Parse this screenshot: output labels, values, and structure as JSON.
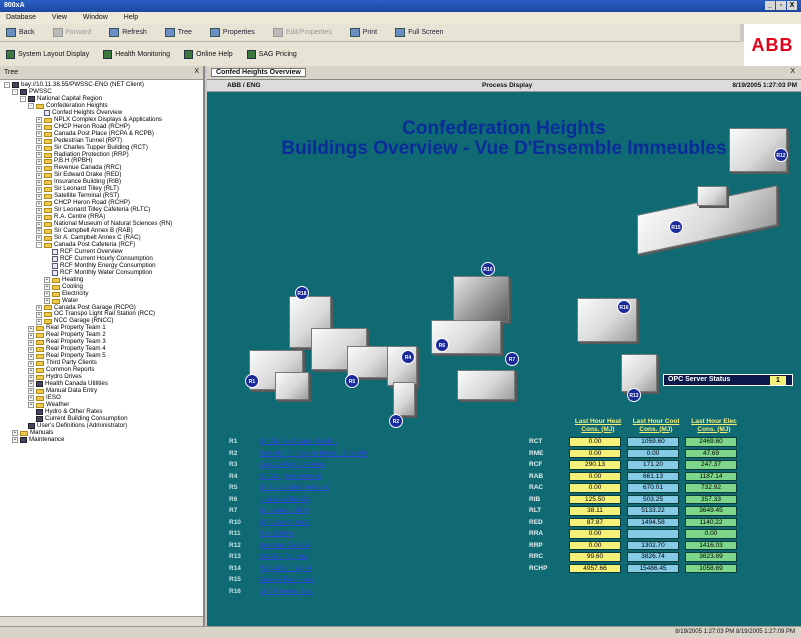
{
  "window": {
    "title": "800xA",
    "controls": [
      "_",
      "▫",
      "X"
    ]
  },
  "menu": [
    "Database",
    "View",
    "Window",
    "Help"
  ],
  "toolbar": [
    {
      "label": "Back",
      "icon": "back-arrow-icon",
      "enabled": true
    },
    {
      "label": "Forward",
      "icon": "forward-arrow-icon",
      "enabled": false
    },
    {
      "label": "Refresh",
      "icon": "refresh-icon",
      "enabled": true
    },
    {
      "label": "Tree",
      "icon": "tree-icon",
      "enabled": true
    },
    {
      "label": "Properties",
      "icon": "properties-icon",
      "enabled": true
    },
    {
      "label": "Edit/Properties",
      "icon": "edit-icon",
      "enabled": false
    },
    {
      "label": "Print",
      "icon": "print-icon",
      "enabled": true
    },
    {
      "label": "Full Screen",
      "icon": "fullscreen-icon",
      "enabled": true
    }
  ],
  "toolbar2": [
    {
      "label": "System Layout Display",
      "icon": "layout-icon"
    },
    {
      "label": "Health Monitoring",
      "icon": "health-icon"
    },
    {
      "label": "Online Help",
      "icon": "help-icon"
    },
    {
      "label": "SAG Pricing",
      "icon": "pricing-icon"
    }
  ],
  "brand": {
    "logo_text": "ABB",
    "color": "#e3001b"
  },
  "tree_panel": {
    "header": "Tree",
    "close": "X",
    "nodes": [
      {
        "label": "bay://10.11.38.55/PWSSC-ENG (NET Client)",
        "depth": 0,
        "icon": "srv",
        "exp": "-"
      },
      {
        "label": "PWSSC",
        "depth": 1,
        "icon": "srv",
        "exp": "-"
      },
      {
        "label": "National Capital Region",
        "depth": 2,
        "icon": "srv",
        "exp": "-"
      },
      {
        "label": "Confederation Heights",
        "depth": 3,
        "icon": "fld",
        "exp": "-"
      },
      {
        "label": "Confed Heights Overview",
        "depth": 4,
        "icon": "doc",
        "exp": ""
      },
      {
        "label": "NPLX Complex Displays & Applications",
        "depth": 4,
        "icon": "fld",
        "exp": "+"
      },
      {
        "label": "CHCP Heron Road (RCHP)",
        "depth": 4,
        "icon": "fld",
        "exp": "+"
      },
      {
        "label": "Canada Post Place (RCPA & RCPB)",
        "depth": 4,
        "icon": "fld",
        "exp": "+"
      },
      {
        "label": "Pedestrian Tunnel (RPT)",
        "depth": 4,
        "icon": "fld",
        "exp": "+"
      },
      {
        "label": "Sir Charles Tupper Building (RCT)",
        "depth": 4,
        "icon": "fld",
        "exp": "+"
      },
      {
        "label": "Radiation Protection (RRP)",
        "depth": 4,
        "icon": "fld",
        "exp": "+"
      },
      {
        "label": "P.B.H (RPBH)",
        "depth": 4,
        "icon": "fld",
        "exp": "+"
      },
      {
        "label": "Revenue Canada (RRC)",
        "depth": 4,
        "icon": "fld",
        "exp": "+"
      },
      {
        "label": "Sir Edward Drake (RED)",
        "depth": 4,
        "icon": "fld",
        "exp": "+"
      },
      {
        "label": "Insurance Building (RIB)",
        "depth": 4,
        "icon": "fld",
        "exp": "+"
      },
      {
        "label": "Sir Leonard Tilley (RLT)",
        "depth": 4,
        "icon": "fld",
        "exp": "+"
      },
      {
        "label": "Satellite Terminal (RST)",
        "depth": 4,
        "icon": "fld",
        "exp": "+"
      },
      {
        "label": "CHCP Heron Road (RCHP)",
        "depth": 4,
        "icon": "fld",
        "exp": "+"
      },
      {
        "label": "Sir Leonard Tilley Cafeteria (RLTC)",
        "depth": 4,
        "icon": "fld",
        "exp": "+"
      },
      {
        "label": "R.A. Centre (RRA)",
        "depth": 4,
        "icon": "fld",
        "exp": "+"
      },
      {
        "label": "National Museum of Natural Sciences (RN)",
        "depth": 4,
        "icon": "fld",
        "exp": "+"
      },
      {
        "label": "Sir Campbell Annex B (RAB)",
        "depth": 4,
        "icon": "fld",
        "exp": "+"
      },
      {
        "label": "Sir A. Campbell Annex C (RAC)",
        "depth": 4,
        "icon": "fld",
        "exp": "+"
      },
      {
        "label": "Canada Post Cafeteria (RCF)",
        "depth": 4,
        "icon": "fld",
        "exp": "-"
      },
      {
        "label": "RCF Current Overview",
        "depth": 5,
        "icon": "doc",
        "exp": ""
      },
      {
        "label": "RCF Current Hourly Consumption",
        "depth": 5,
        "icon": "doc",
        "exp": ""
      },
      {
        "label": "RCF Monthly Energy Consumption",
        "depth": 5,
        "icon": "doc",
        "exp": ""
      },
      {
        "label": "RCF Monthly Water Consumption",
        "depth": 5,
        "icon": "doc",
        "exp": ""
      },
      {
        "label": "Heating",
        "depth": 5,
        "icon": "fld",
        "exp": "+"
      },
      {
        "label": "Cooling",
        "depth": 5,
        "icon": "fld",
        "exp": "+"
      },
      {
        "label": "Electricity",
        "depth": 5,
        "icon": "fld",
        "exp": "+"
      },
      {
        "label": "Water",
        "depth": 5,
        "icon": "fld",
        "exp": "+"
      },
      {
        "label": "Canada Post Garage (RCPG)",
        "depth": 4,
        "icon": "fld",
        "exp": "+"
      },
      {
        "label": "OC Transpo Light Rail Station (RCC)",
        "depth": 4,
        "icon": "fld",
        "exp": "+"
      },
      {
        "label": "NCC Garage (RNCC)",
        "depth": 4,
        "icon": "fld",
        "exp": "+"
      },
      {
        "label": "Real Property Team 1",
        "depth": 3,
        "icon": "fld",
        "exp": "+"
      },
      {
        "label": "Real Property Team 2",
        "depth": 3,
        "icon": "fld",
        "exp": "+"
      },
      {
        "label": "Real Property Team 3",
        "depth": 3,
        "icon": "fld",
        "exp": "+"
      },
      {
        "label": "Real Property Team 4",
        "depth": 3,
        "icon": "fld",
        "exp": "+"
      },
      {
        "label": "Real Property Team 5",
        "depth": 3,
        "icon": "fld",
        "exp": "+"
      },
      {
        "label": "Third Party Clients",
        "depth": 3,
        "icon": "fld",
        "exp": "+"
      },
      {
        "label": "Common Reports",
        "depth": 3,
        "icon": "fld",
        "exp": "+"
      },
      {
        "label": "Hydro Drives",
        "depth": 3,
        "icon": "fld",
        "exp": "+"
      },
      {
        "label": "Health Canada Utilities",
        "depth": 3,
        "icon": "srv",
        "exp": "+"
      },
      {
        "label": "Manual Data Entry",
        "depth": 3,
        "icon": "fld",
        "exp": "+"
      },
      {
        "label": "IESO",
        "depth": 3,
        "icon": "fld",
        "exp": "+"
      },
      {
        "label": "Weather",
        "depth": 3,
        "icon": "fld",
        "exp": "+"
      },
      {
        "label": "Hydro & Other Rates",
        "depth": 3,
        "icon": "srv",
        "exp": ""
      },
      {
        "label": "Current Building Consumption",
        "depth": 3,
        "icon": "srv",
        "exp": ""
      },
      {
        "label": "User's Definitions (Administrator)",
        "depth": 2,
        "icon": "srv",
        "exp": ""
      },
      {
        "label": "Manuals",
        "depth": 1,
        "icon": "fld",
        "exp": "+"
      },
      {
        "label": "Maintenance",
        "depth": 1,
        "icon": "srv",
        "exp": "+"
      }
    ]
  },
  "document": {
    "tab": "Confed Heights Overview",
    "close": "X",
    "info_left": "ABB / ENG",
    "info_center": "Process Display",
    "info_right": "8/19/2005 1:27:03 PM",
    "title_line1": "Confederation Heights",
    "title_line2": "Buildings Overview - Vue D'Ensemble Immeubles",
    "opc_label": "OPC Server Status",
    "opc_value": "1",
    "col_heat": "Last Hour Heat Cons. (MJ)",
    "col_cool": "Last Hour Cool Cons. (MJ)",
    "col_elec": "Last Hour Elec Cons. (MJ)",
    "building_marks": [
      "R12",
      "R10",
      "R15",
      "R18",
      "R3",
      "R4",
      "R5",
      "R6",
      "R7",
      "R1",
      "R9",
      "R2",
      "R16",
      "R13"
    ],
    "legend": [
      {
        "code": "R1",
        "name": "Sir Charles Tupper Building"
      },
      {
        "code": "R2",
        "name": "Radiation Protection Bureau & Health"
      },
      {
        "code": "R3",
        "name": "Canada Post Cafeteria"
      },
      {
        "code": "R4",
        "name": "Sir Campbell Annex B"
      },
      {
        "code": "R5",
        "name": "Sir A. Campbell Annex C"
      },
      {
        "code": "R6",
        "name": "Insurance Building"
      },
      {
        "code": "R7",
        "name": "Sir Leonard Tilley"
      },
      {
        "code": "R10",
        "name": "Sir Edward Drake"
      },
      {
        "code": "R11",
        "name": "R.A. Centre"
      },
      {
        "code": "R12",
        "name": "Revenue Canada"
      },
      {
        "code": "R13",
        "name": "Satellite Terminal"
      },
      {
        "code": "R14",
        "name": "Pedestrian Tunnel"
      },
      {
        "code": "R15",
        "name": "Canada Post Place"
      },
      {
        "code": "R16",
        "name": "CHCP Heron Road"
      }
    ],
    "rows": [
      {
        "code": "RCT",
        "heat": "0.00",
        "cool": "1059.60",
        "elec": "2469.60"
      },
      {
        "code": "RME",
        "heat": "0.00",
        "cool": "0.00",
        "elec": "47.69"
      },
      {
        "code": "RCF",
        "heat": "290.13",
        "cool": "171.20",
        "elec": "247.37"
      },
      {
        "code": "RAB",
        "heat": "0.00",
        "cool": "661.13",
        "elec": "1187.14"
      },
      {
        "code": "RAC",
        "heat": "0.00",
        "cool": "670.01",
        "elec": "732.92"
      },
      {
        "code": "RIB",
        "heat": "125.50",
        "cool": "503.25",
        "elec": "357.33"
      },
      {
        "code": "RLT",
        "heat": "38.11",
        "cool": "5133.22",
        "elec": "3649.45"
      },
      {
        "code": "RED",
        "heat": "87.87",
        "cool": "1494.58",
        "elec": "1140.22"
      },
      {
        "code": "RRA",
        "heat": "0.00",
        "cool": "",
        "elec": "0.00"
      },
      {
        "code": "RRP",
        "heat": "0.00",
        "cool": "1302.70",
        "elec": "1416.03"
      },
      {
        "code": "RRC",
        "heat": "99.60",
        "cool": "3826.74",
        "elec": "3623.89"
      },
      {
        "code": "RCHP",
        "heat": "4957.66",
        "cool": "15486.45",
        "elec": "1058.69"
      }
    ]
  },
  "status": {
    "left": "",
    "right": "8/19/2005 1:27:03 PM   8/19/2005 1:27:09 PM"
  }
}
